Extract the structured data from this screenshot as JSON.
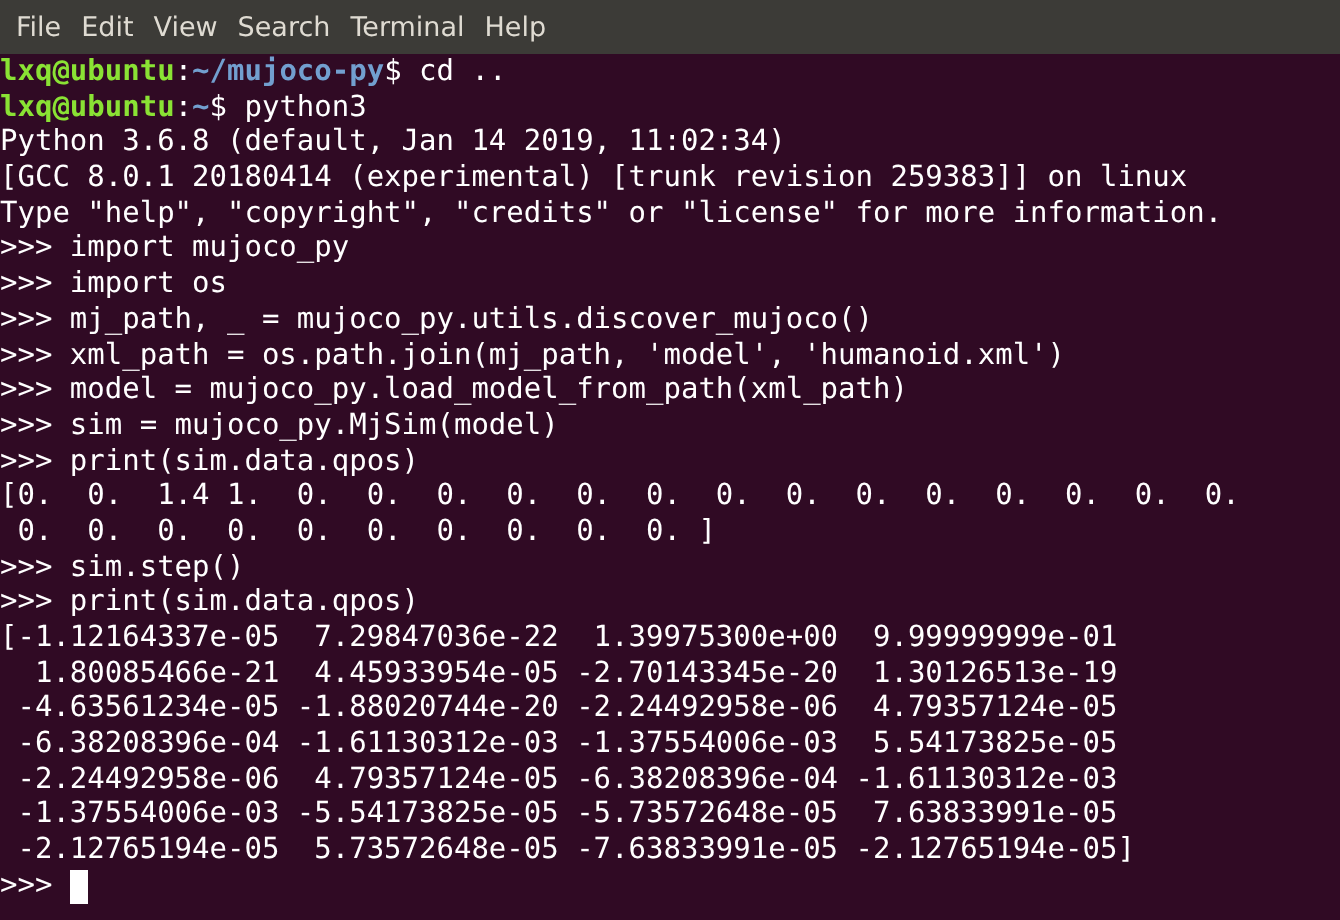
{
  "menu": [
    "File",
    "Edit",
    "View",
    "Search",
    "Terminal",
    "Help"
  ],
  "lines": [
    {
      "kind": "prompt",
      "user": "lxq@ubuntu",
      "sep": ":",
      "path": "~/mujoco-py",
      "command": "$ cd .."
    },
    {
      "kind": "prompt",
      "user": "lxq@ubuntu",
      "sep": ":",
      "path": "~",
      "command": "$ python3"
    },
    {
      "kind": "output",
      "text": "Python 3.6.8 (default, Jan 14 2019, 11:02:34)"
    },
    {
      "kind": "output",
      "text": "[GCC 8.0.1 20180414 (experimental) [trunk revision 259383]] on linux"
    },
    {
      "kind": "output",
      "text": "Type \"help\", \"copyright\", \"credits\" or \"license\" for more information."
    },
    {
      "kind": "output",
      "text": ">>> import mujoco_py"
    },
    {
      "kind": "output",
      "text": ">>> import os"
    },
    {
      "kind": "output",
      "text": ">>> mj_path, _ = mujoco_py.utils.discover_mujoco()"
    },
    {
      "kind": "output",
      "text": ">>> xml_path = os.path.join(mj_path, 'model', 'humanoid.xml')"
    },
    {
      "kind": "output",
      "text": ">>> model = mujoco_py.load_model_from_path(xml_path)"
    },
    {
      "kind": "output",
      "text": ">>> sim = mujoco_py.MjSim(model)"
    },
    {
      "kind": "output",
      "text": ">>> print(sim.data.qpos)"
    },
    {
      "kind": "output",
      "text": "[0.  0.  1.4 1.  0.  0.  0.  0.  0.  0.  0.  0.  0.  0.  0.  0.  0.  0."
    },
    {
      "kind": "output",
      "text": " 0.  0.  0.  0.  0.  0.  0.  0.  0.  0. ]"
    },
    {
      "kind": "output",
      "text": ">>> sim.step()"
    },
    {
      "kind": "output",
      "text": ">>> print(sim.data.qpos)"
    },
    {
      "kind": "output",
      "text": "[-1.12164337e-05  7.29847036e-22  1.39975300e+00  9.99999999e-01"
    },
    {
      "kind": "output",
      "text": "  1.80085466e-21  4.45933954e-05 -2.70143345e-20  1.30126513e-19"
    },
    {
      "kind": "output",
      "text": " -4.63561234e-05 -1.88020744e-20 -2.24492958e-06  4.79357124e-05"
    },
    {
      "kind": "output",
      "text": " -6.38208396e-04 -1.61130312e-03 -1.37554006e-03  5.54173825e-05"
    },
    {
      "kind": "output",
      "text": " -2.24492958e-06  4.79357124e-05 -6.38208396e-04 -1.61130312e-03"
    },
    {
      "kind": "output",
      "text": " -1.37554006e-03 -5.54173825e-05 -5.73572648e-05  7.63833991e-05"
    },
    {
      "kind": "output",
      "text": " -2.12765194e-05  5.73572648e-05 -7.63833991e-05 -2.12765194e-05]"
    },
    {
      "kind": "input",
      "text": ">>>",
      "cursor": true
    }
  ]
}
